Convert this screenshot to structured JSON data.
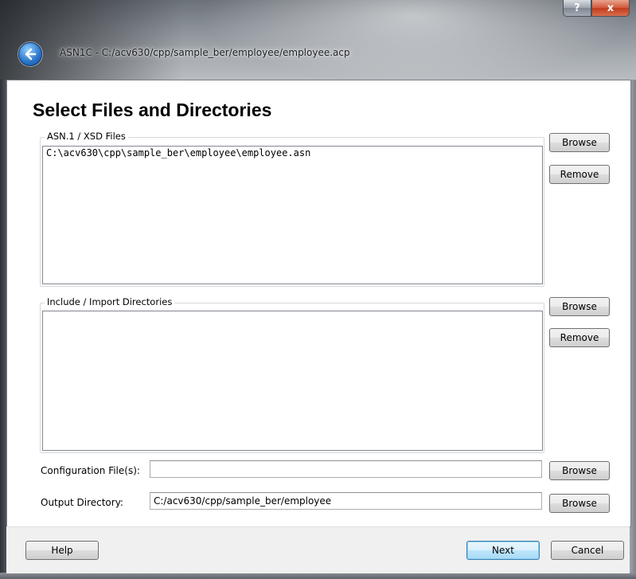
{
  "window": {
    "title": "ASN1C - C:/acv630/cpp/sample_ber/employee/employee.acp",
    "help_caption": "?",
    "close_caption": "x"
  },
  "page": {
    "heading": "Select Files and Directories"
  },
  "asn_files": {
    "label": "ASN.1 / XSD Files",
    "items": [
      "C:\\acv630\\cpp\\sample_ber\\employee\\employee.asn"
    ],
    "browse_label": "Browse",
    "remove_label": "Remove"
  },
  "include_dirs": {
    "label": "Include / Import Directories",
    "items": [],
    "browse_label": "Browse",
    "remove_label": "Remove"
  },
  "config_files": {
    "label": "Configuration File(s):",
    "value": "",
    "browse_label": "Browse"
  },
  "output_dir": {
    "label": "Output Directory:",
    "value": "C:/acv630/cpp/sample_ber/employee",
    "browse_label": "Browse"
  },
  "footer": {
    "help_label": "Help",
    "next_label": "Next",
    "cancel_label": "Cancel"
  }
}
